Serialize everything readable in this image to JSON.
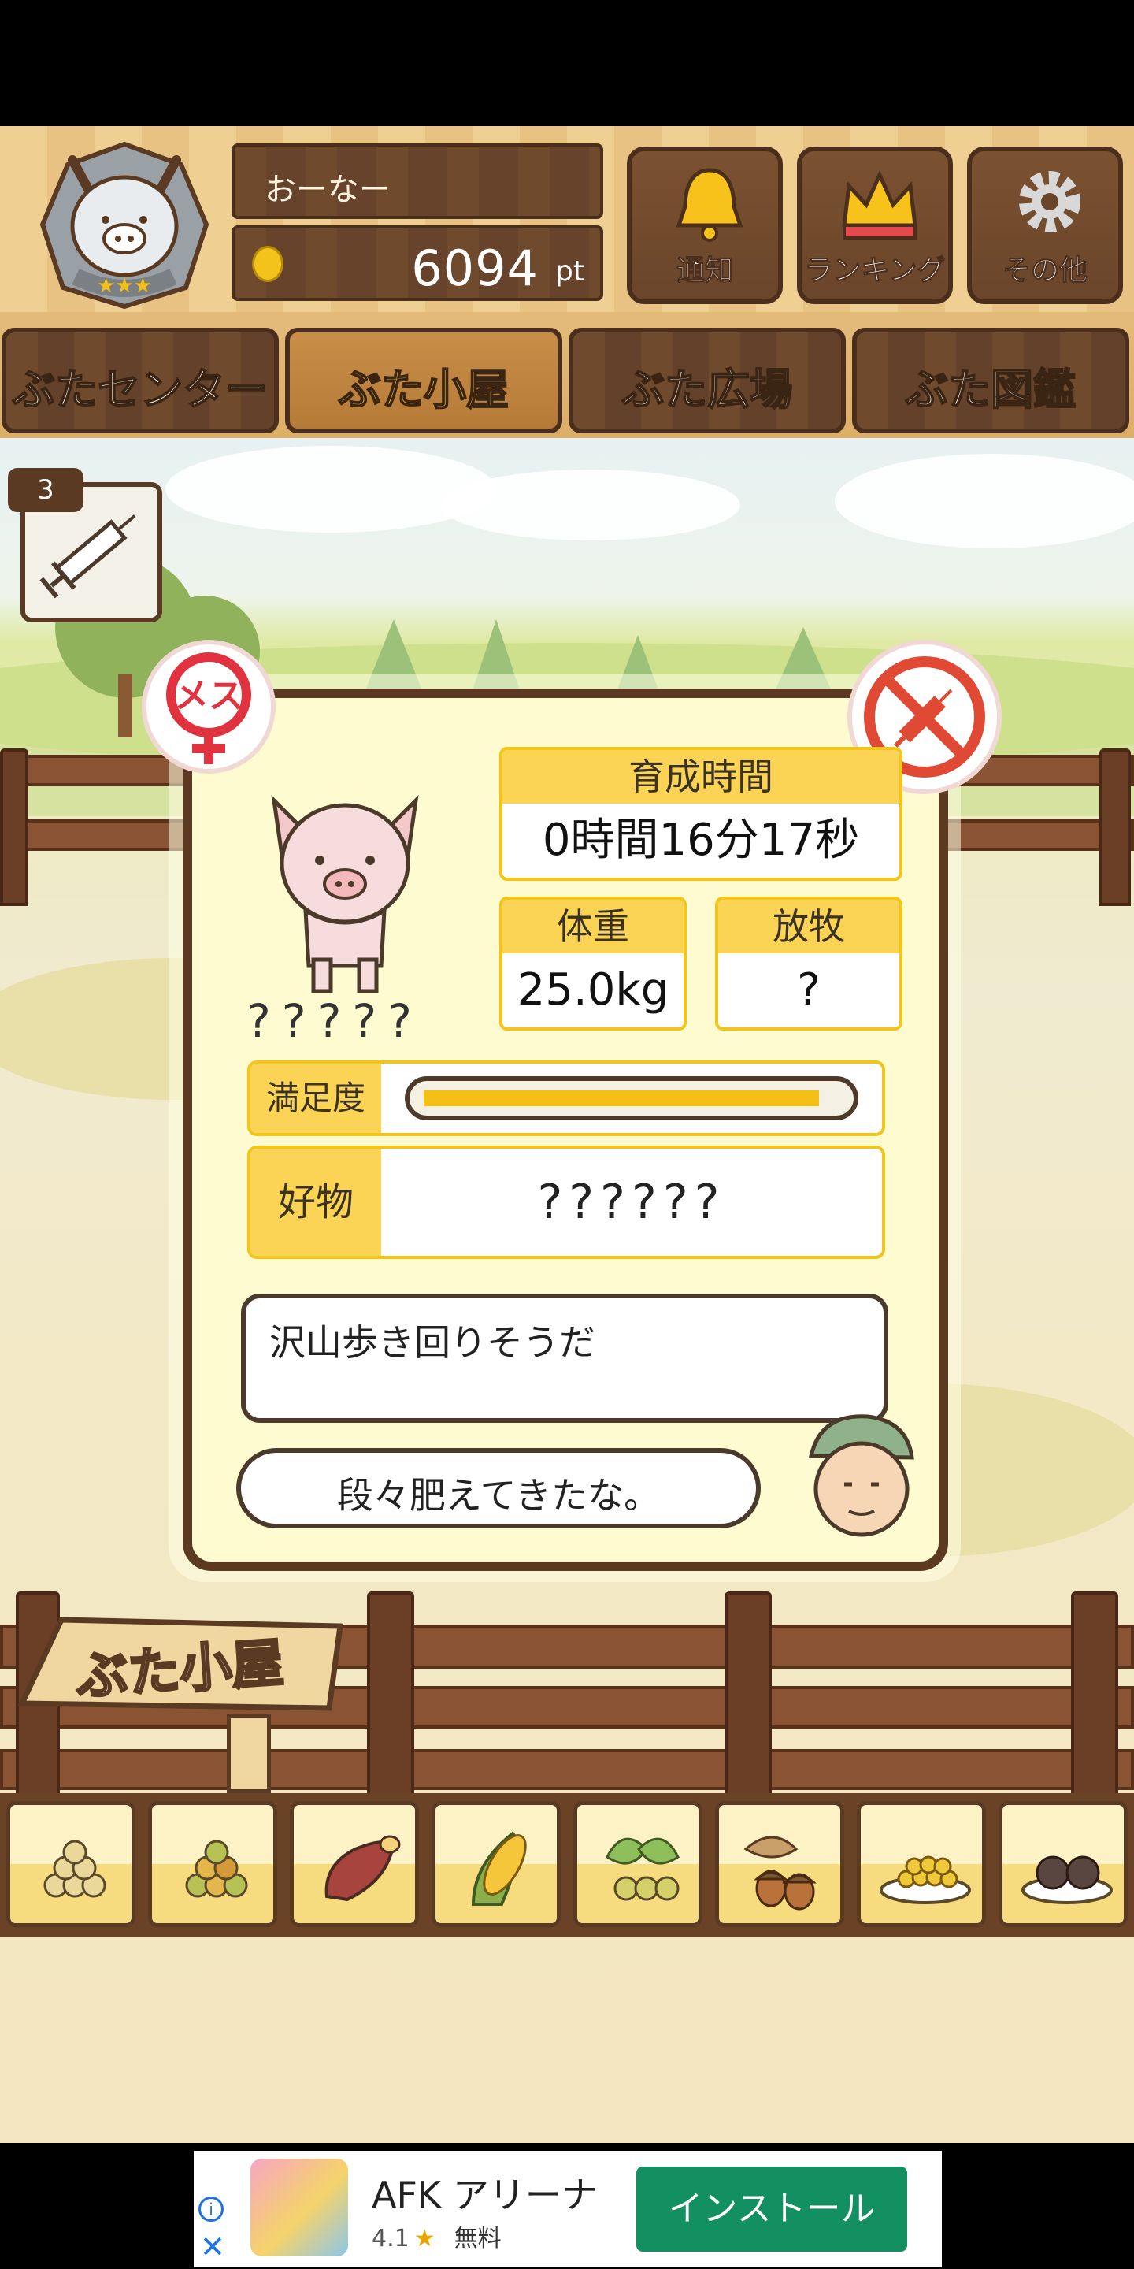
{
  "header": {
    "owner_name": "おーなー",
    "points_value": "6094",
    "points_unit": "pt",
    "buttons": [
      {
        "label": "通知",
        "icon": "bell-icon"
      },
      {
        "label": "ランキング",
        "icon": "crown-icon"
      },
      {
        "label": "その他",
        "icon": "gear-icon"
      }
    ]
  },
  "tabs": [
    {
      "label": "ぶたセンター",
      "active": false
    },
    {
      "label": "ぶた小屋",
      "active": true
    },
    {
      "label": "ぶた広場",
      "active": false
    },
    {
      "label": "ぶた図鑑",
      "active": false
    }
  ],
  "syringe": {
    "count": "3",
    "icon": "syringe-icon"
  },
  "pig": {
    "sex_badge": "メス",
    "name": "?????",
    "raising_time_label": "育成時間",
    "raising_time_value": "0時間16分17秒",
    "weight_label": "体重",
    "weight_value": "25.0kg",
    "grazing_label": "放牧",
    "grazing_value": "?",
    "satisfaction_label": "満足度",
    "satisfaction_level": 0.95,
    "favorite_label": "好物",
    "favorite_value": "??????",
    "comment": "沢山歩き回りそうだ",
    "farmer_comment": "段々肥えてきたな。"
  },
  "sign_label": "ぶた小屋",
  "foods": [
    "soybeans",
    "mixed-beans",
    "sweet-potato",
    "corn",
    "ginkgo-leaves",
    "acorns",
    "grain-plate",
    "truffles"
  ],
  "ad": {
    "title": "AFK アリーナ",
    "rating": "4.1",
    "star": "★",
    "price": "無料",
    "install_label": "インストール",
    "info_glyph": "i",
    "close_glyph": "✕"
  },
  "colors": {
    "wood_dark": "#5c3a22",
    "accent_yellow": "#fbd455",
    "panel_bg": "#fefbd0",
    "install_green": "#139062"
  }
}
